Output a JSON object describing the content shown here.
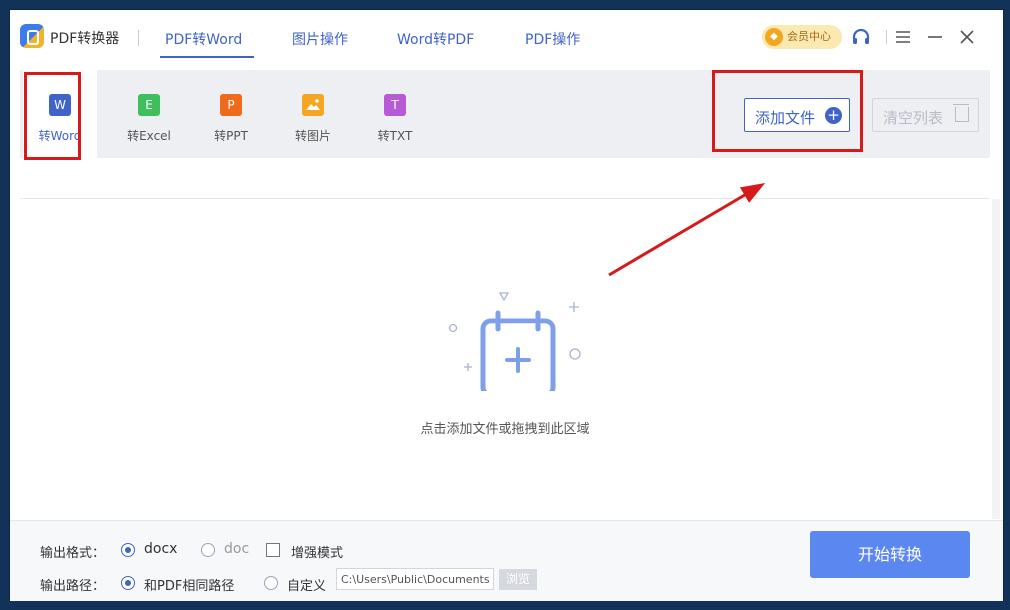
{
  "app": {
    "title": "PDF转换器"
  },
  "nav": {
    "tabs": [
      {
        "label": "PDF转Word"
      },
      {
        "label": "图片操作"
      },
      {
        "label": "Word转PDF"
      },
      {
        "label": "PDF操作"
      }
    ]
  },
  "titlebar": {
    "vip_label": "会员中心"
  },
  "tools": [
    {
      "label": "转Word",
      "icon": "W",
      "color": "#3f63c9"
    },
    {
      "label": "转Excel",
      "icon": "E",
      "color": "#3fbf5b"
    },
    {
      "label": "转PPT",
      "icon": "P",
      "color": "#f06a1c"
    },
    {
      "label": "转图片",
      "icon": "image",
      "color": "#f4a623"
    },
    {
      "label": "转TXT",
      "icon": "T",
      "color": "#b65ad6"
    }
  ],
  "actions": {
    "add_label": "添加文件",
    "clear_label": "清空列表"
  },
  "dropzone": {
    "hint": "点击添加文件或拖拽到此区域"
  },
  "output": {
    "format_label": "输出格式：",
    "formats": [
      "docx",
      "doc"
    ],
    "selected_format": "docx",
    "enhanced_label": "增强模式",
    "path_label": "输出路径：",
    "path_options": [
      "和PDF相同路径",
      "自定义"
    ],
    "selected_path": "和PDF相同路径",
    "custom_path": "C:\\Users\\Public\\Documents",
    "browse_label": "浏览"
  },
  "start_label": "开始转换",
  "colors": {
    "accent": "#3f63c9",
    "start": "#5b87f0",
    "annotation": "#d61a1a"
  }
}
